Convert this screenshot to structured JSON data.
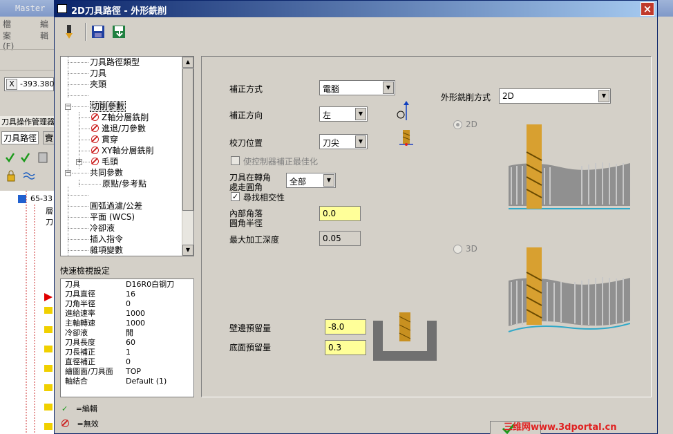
{
  "background": {
    "app_title": "Master",
    "menu": [
      "檔案(F)",
      "編輯"
    ],
    "coord_value": "-393.380",
    "ops_manager": "刀具操作管理器",
    "tab_toolpath": "刀具路徑",
    "tab_solids": "實",
    "tree_root": "65-33",
    "tree_items": [
      "層",
      "刀"
    ]
  },
  "dialog": {
    "title": "2D刀具路徑 - 外形銑削",
    "close": "×"
  },
  "toolbar": [
    "tool-icon",
    "save-icon",
    "save-as-icon"
  ],
  "tree": {
    "items": [
      {
        "label": "刀具路徑類型"
      },
      {
        "label": "刀具"
      },
      {
        "label": "夾頭"
      },
      {
        "label": ""
      },
      {
        "label": "切削參數",
        "selected": true
      },
      {
        "label": "Z軸分層銑削"
      },
      {
        "label": "進退/刀參數"
      },
      {
        "label": "貫穿"
      },
      {
        "label": "XY軸分層銑削"
      },
      {
        "label": "毛頭"
      },
      {
        "label": "共同參數"
      },
      {
        "label": "原點/參考點"
      },
      {
        "label": ""
      },
      {
        "label": "圓弧過濾/公差"
      },
      {
        "label": "平面 (WCS)"
      },
      {
        "label": "冷卻液"
      },
      {
        "label": "插入指令"
      },
      {
        "label": "雜項變數"
      }
    ]
  },
  "quickview": {
    "title": "快速檢視設定",
    "rows": [
      {
        "k": "刀具",
        "v": "D16R0白钢刀"
      },
      {
        "k": "刀具直徑",
        "v": "16"
      },
      {
        "k": "刀角半徑",
        "v": "0"
      },
      {
        "k": "進給速率",
        "v": "1000"
      },
      {
        "k": "主軸轉速",
        "v": "1000"
      },
      {
        "k": "冷卻液",
        "v": "開"
      },
      {
        "k": "刀具長度",
        "v": "60"
      },
      {
        "k": "刀長補正",
        "v": "1"
      },
      {
        "k": "直徑補正",
        "v": "0"
      },
      {
        "k": "繪圖面/刀具面",
        "v": "TOP"
      },
      {
        "k": "軸結合",
        "v": "Default (1)"
      }
    ]
  },
  "legend": {
    "edited": "=編輯",
    "disabled": "=無效"
  },
  "params": {
    "comp_type_label": "補正方式",
    "comp_type_value": "電腦",
    "comp_dir_label": "補正方向",
    "comp_dir_value": "左",
    "tip_comp_label": "校刀位置",
    "tip_comp_value": "刀尖",
    "optimize_label": "使控制器補正最佳化",
    "roll_label_1": "刀具在轉角",
    "roll_label_2": "處走圓角",
    "roll_value": "全部",
    "infinite_label": "尋找相交性",
    "corner_label_1": "內部角落",
    "corner_label_2": "圓角半徑",
    "corner_value": "0.0",
    "max_depth_label": "最大加工深度",
    "max_depth_value": "0.05",
    "wall_stock_label": "壁邊預留量",
    "wall_stock_value": "-8.0",
    "floor_stock_label": "底面預留量",
    "floor_stock_value": "0.3",
    "contour_type_label": "外形銑削方式",
    "contour_type_value": "2D",
    "radio_2d": "2D",
    "radio_3d": "3D"
  },
  "watermark": "三维网www.3dportal.cn"
}
